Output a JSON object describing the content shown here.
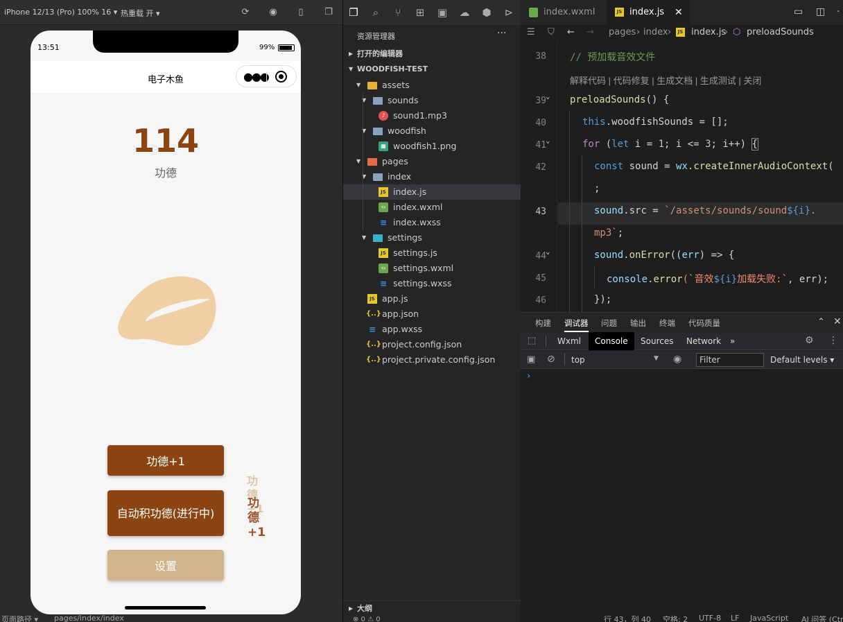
{
  "simulator": {
    "device": "iPhone 12/13 (Pro) 100% 16 ▾",
    "hot_reload": "热重载 开 ▾",
    "status_time": "13:51",
    "battery": "99%",
    "nav_title": "电子木鱼",
    "merit_count": "114",
    "merit_label": "功德",
    "btn_merit": "功德+1",
    "btn_auto": "自动积功德(进行中)",
    "btn_settings": "设置",
    "float_text_1": "功德+1",
    "float_text_2": "功德+1",
    "status_path_label": "页面路径 ▾",
    "status_path": "pages/index/index"
  },
  "explorer": {
    "title": "资源管理器",
    "more": "···",
    "open_editors": "打开的编辑器",
    "project": "WOODFISH-TEST",
    "tree": [
      {
        "label": "assets",
        "type": "folder"
      },
      {
        "label": "sounds",
        "type": "folder"
      },
      {
        "label": "sound1.mp3",
        "type": "mp3"
      },
      {
        "label": "woodfish",
        "type": "folder"
      },
      {
        "label": "woodfish1.png",
        "type": "png"
      },
      {
        "label": "pages",
        "type": "folder"
      },
      {
        "label": "index",
        "type": "folder"
      },
      {
        "label": "index.js",
        "type": "js"
      },
      {
        "label": "index.wxml",
        "type": "wxml"
      },
      {
        "label": "index.wxss",
        "type": "wxss"
      },
      {
        "label": "settings",
        "type": "folder"
      },
      {
        "label": "settings.js",
        "type": "js"
      },
      {
        "label": "settings.wxml",
        "type": "wxml"
      },
      {
        "label": "settings.wxss",
        "type": "wxss"
      },
      {
        "label": "app.js",
        "type": "js"
      },
      {
        "label": "app.json",
        "type": "json"
      },
      {
        "label": "app.wxss",
        "type": "wxss"
      },
      {
        "label": "project.config.json",
        "type": "json"
      },
      {
        "label": "project.private.config.json",
        "type": "json"
      }
    ],
    "outline": "大纲",
    "problems": "⊗ 0 ⚠ 0"
  },
  "editor": {
    "tab1": "index.wxml",
    "tab2": "index.js",
    "crumb": [
      "pages",
      "index",
      "index.js",
      "preloadSounds"
    ],
    "codelens": "解释代码 | 代码修复 | 生成文档 | 生成测试 | 关闭",
    "line_numbers": [
      "38",
      "39",
      "40",
      "41",
      "42",
      "43",
      "44",
      "45",
      "46"
    ],
    "code": {
      "l38": "// 预加载音效文件",
      "l39a": "preloadSounds",
      "l39b": "() {",
      "l40a": "this",
      "l40b": ".woodfishSounds = [];",
      "l41a": "for",
      "l41b": " (",
      "l41c": "let",
      "l41d": " i = ",
      "l41e": "1",
      "l41f": "; i <= ",
      "l41g": "3",
      "l41h": "; i++) ",
      "l41i": "{",
      "l42a": "const",
      "l42b": " sound = ",
      "l42c": "wx",
      "l42d": ".",
      "l42e": "createInnerAudioContext",
      "l42f": "(",
      "l42g": ";",
      "l43a": "sound",
      "l43b": ".src = ",
      "l43c": "`/assets/sounds/sound",
      "l43d": "${i}",
      "l43e": ".",
      "l43f": "mp3`",
      "l43g": ";",
      "l44a": "sound",
      "l44b": ".",
      "l44c": "onError",
      "l44d": "((",
      "l44e": "err",
      "l44f": ") => {",
      "l45a": "console",
      "l45b": ".",
      "l45c": "error",
      "l45d": "(`",
      "l45e": "音效",
      "l45f": "${i}",
      "l45g": "加载失败:`",
      "l45h": ", err);",
      "l46": "});"
    }
  },
  "devtools": {
    "tabs": [
      "构建",
      "调试器",
      "问题",
      "输出",
      "终端",
      "代码质量"
    ],
    "panel_tabs": [
      "Wxml",
      "Console",
      "Sources",
      "Network"
    ],
    "more_panels": "»",
    "context": "top",
    "filter_placeholder": "Filter",
    "levels": "Default levels ▾",
    "prompt": "›"
  },
  "statusbar": {
    "items": [
      "行 43，列 40",
      "空格: 2",
      "UTF-8",
      "LF",
      "JavaScript",
      "AI 问答 (Ctrl"
    ]
  }
}
